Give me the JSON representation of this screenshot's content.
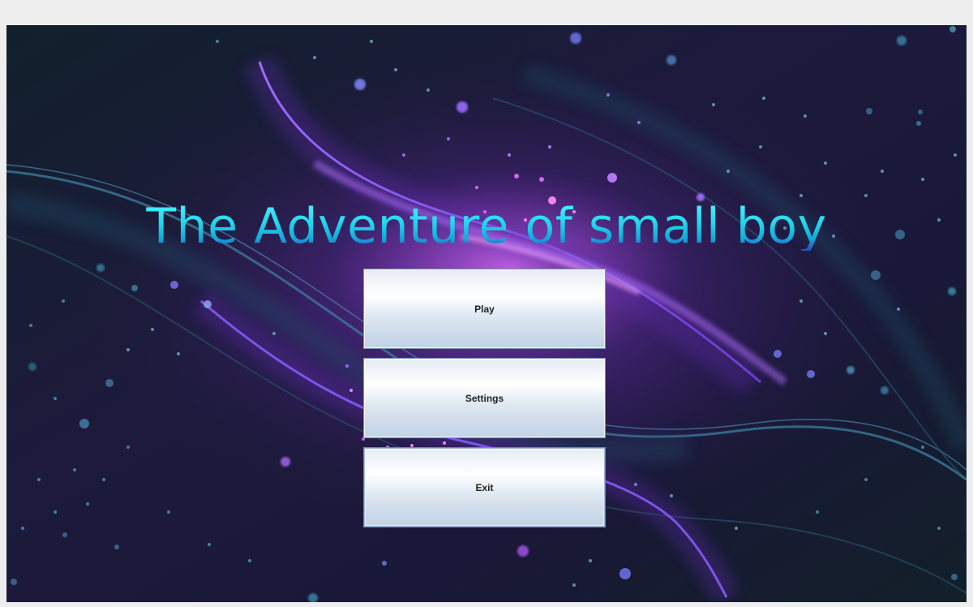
{
  "game": {
    "title": "The Adventure of small boy"
  },
  "menu": {
    "play_label": "Play",
    "settings_label": "Settings",
    "exit_label": "Exit"
  },
  "colors": {
    "title_cyan": "#1fd6ec",
    "background_dark": "#151a28",
    "nebula_purple": "#8a4fe0",
    "button_light": "#e2ebf4"
  }
}
